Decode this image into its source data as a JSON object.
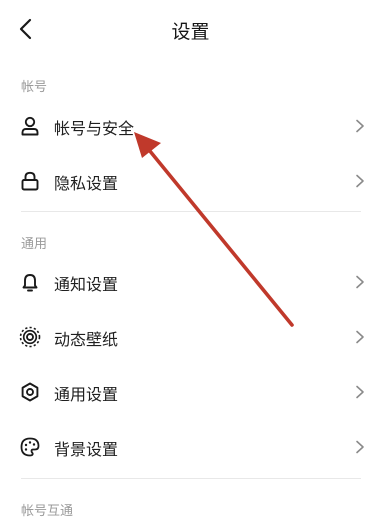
{
  "header": {
    "title": "设置",
    "back_icon": "chevron-left-icon"
  },
  "sections": [
    {
      "label": "帐号",
      "items": [
        {
          "label": "帐号与安全",
          "icon": "user-icon"
        },
        {
          "label": "隐私设置",
          "icon": "lock-icon"
        }
      ]
    },
    {
      "label": "通用",
      "items": [
        {
          "label": "通知设置",
          "icon": "bell-icon"
        },
        {
          "label": "动态壁纸",
          "icon": "live-wallpaper-icon"
        },
        {
          "label": "通用设置",
          "icon": "gear-icon"
        },
        {
          "label": "背景设置",
          "icon": "palette-icon"
        }
      ]
    },
    {
      "label": "帐号互通",
      "items": []
    }
  ],
  "annotation": {
    "color": "#c0392b",
    "icon": "red-arrow-annotation"
  }
}
